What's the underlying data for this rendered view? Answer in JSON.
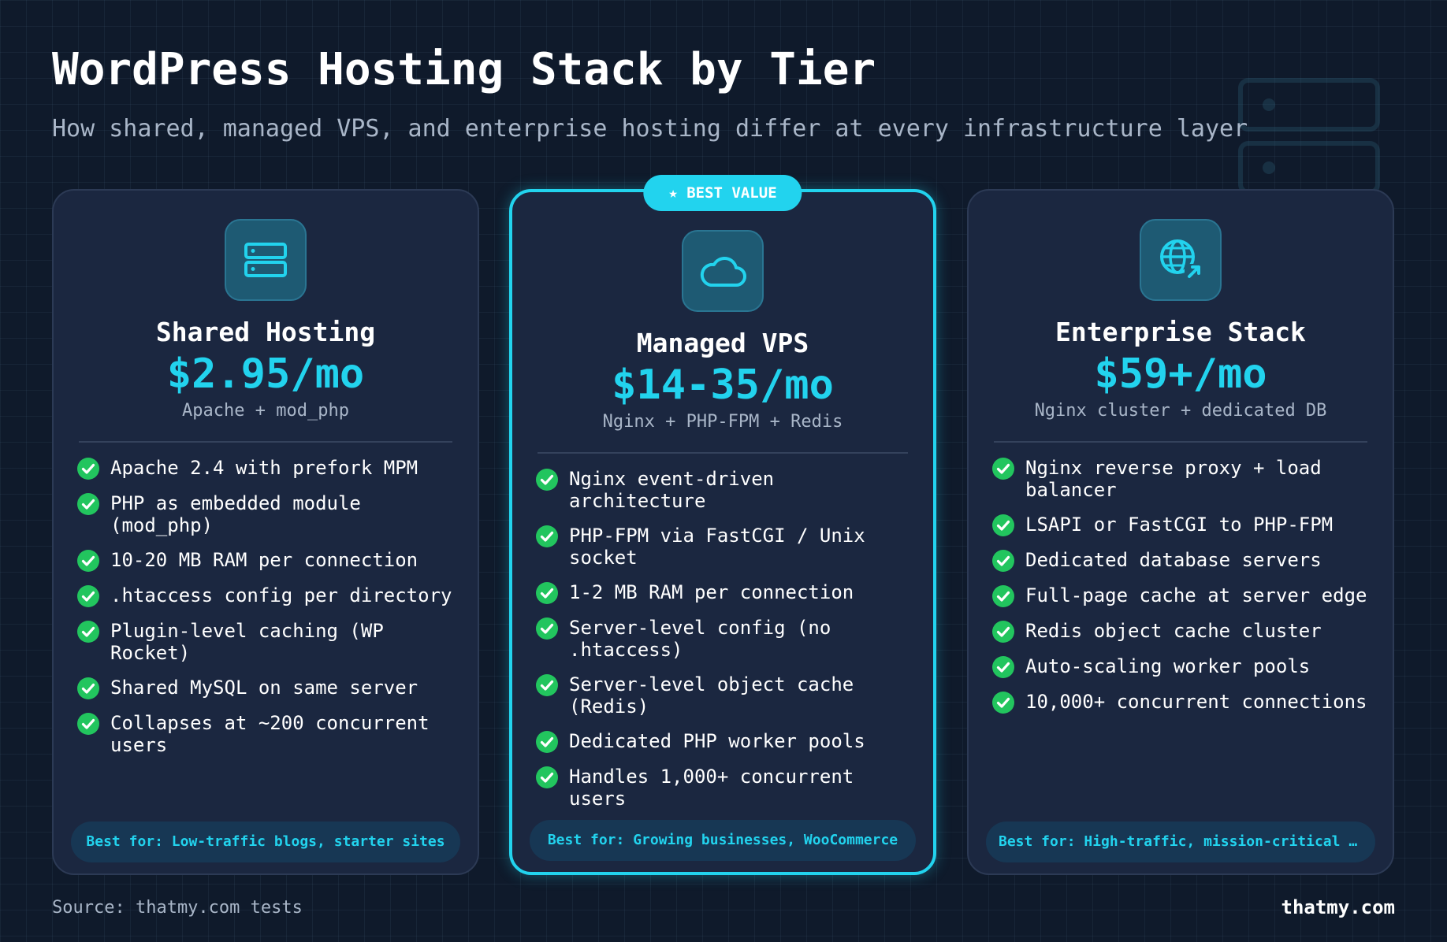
{
  "header": {
    "title": "WordPress Hosting Stack by Tier",
    "subtitle": "How shared, managed VPS, and enterprise hosting differ at every infrastructure layer"
  },
  "colors": {
    "background": "#0f1a2b",
    "card": "#1b2740",
    "accent": "#22d3ee",
    "check": "#22c55e",
    "muted_text": "#a9b6c8"
  },
  "tiers": [
    {
      "icon": "server-icon",
      "name": "Shared Hosting",
      "price": "$2.95/mo",
      "stack": "Apache + mod_php",
      "features": [
        "Apache 2.4 with prefork MPM",
        "PHP as embedded module (mod_php)",
        "10-20 MB RAM per connection",
        ".htaccess config per directory",
        "Plugin-level caching (WP Rocket)",
        "Shared MySQL on same server",
        "Collapses at ~200 concurrent users"
      ],
      "best_for": "Best for: Low-traffic blogs, starter sites"
    },
    {
      "icon": "cloud-icon",
      "badge": "★ BEST VALUE",
      "name": "Managed VPS",
      "price": "$14-35/mo",
      "stack": "Nginx + PHP-FPM + Redis",
      "features": [
        "Nginx event-driven architecture",
        "PHP-FPM via FastCGI / Unix socket",
        "1-2 MB RAM per connection",
        "Server-level config (no .htaccess)",
        "Server-level object cache (Redis)",
        "Dedicated PHP worker pools",
        "Handles 1,000+ concurrent users"
      ],
      "best_for": "Best for: Growing businesses, WooCommerce"
    },
    {
      "icon": "globe-icon",
      "name": "Enterprise Stack",
      "price": "$59+/mo",
      "stack": "Nginx cluster + dedicated DB",
      "features": [
        "Nginx reverse proxy + load balancer",
        "LSAPI or FastCGI to PHP-FPM",
        "Dedicated database servers",
        "Full-page cache at server edge",
        "Redis object cache cluster",
        "Auto-scaling worker pools",
        "10,000+ concurrent connections"
      ],
      "best_for": "Best for: High-traffic, mission-critical si…"
    }
  ],
  "footer": {
    "source": "Source: thatmy.com tests",
    "brand": "thatmy.com"
  }
}
